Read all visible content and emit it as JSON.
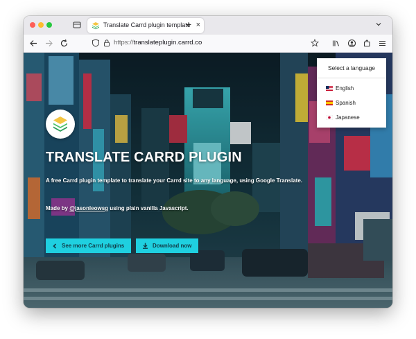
{
  "browser": {
    "tab_title": "Translate Carrd plugin template",
    "tab_close": "×",
    "new_tab": "+",
    "url_scheme": "https://",
    "url_domain": "translateplugin.carrd.co"
  },
  "hero": {
    "title": "TRANSLATE CARRD PLUGIN",
    "description": "A free Carrd plugin template to translate your Carrd site to any language, using Google Translate.",
    "made_prefix": "Made by ",
    "made_author": "@jasonleowsg",
    "made_suffix": " using plain vanilla Javascript.",
    "btn_more": "See more Carrd plugins",
    "btn_download": "Download now"
  },
  "language": {
    "header": "Select a language",
    "options": [
      "English",
      "Spanish",
      "Japanese"
    ]
  },
  "icons": {
    "back": "arrow-left-icon",
    "forward": "arrow-right-icon",
    "reload": "reload-icon",
    "shield": "shield-icon",
    "lock": "lock-icon",
    "bookmark": "star-icon",
    "library": "library-icon",
    "account": "account-icon",
    "extensions": "puzzle-icon",
    "menu": "hamburger-icon"
  },
  "colors": {
    "accent": "#1fd0e0",
    "hero_text": "#ffffff"
  }
}
